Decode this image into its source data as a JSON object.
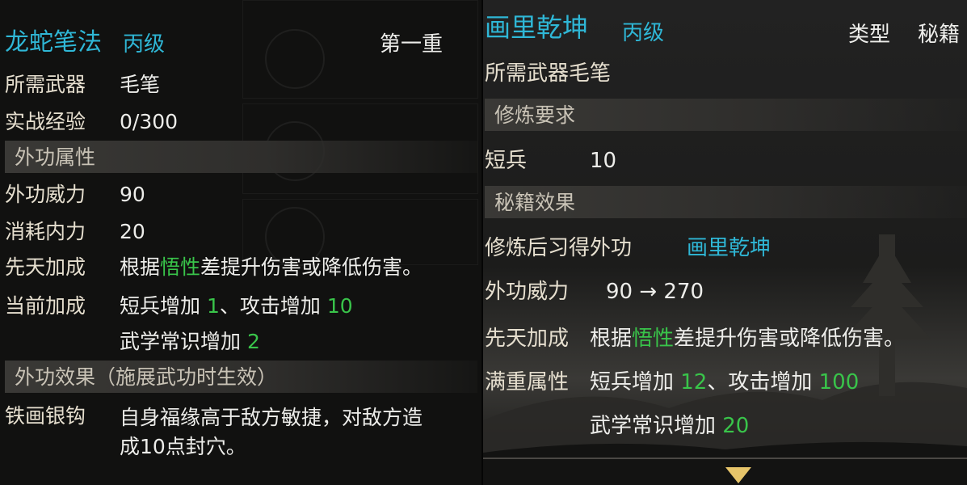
{
  "left": {
    "title": "龙蛇笔法",
    "grade": "丙级",
    "tier": "第一重",
    "weapon_label": "所需武器",
    "weapon_value": "毛笔",
    "exp_label": "实战经验",
    "exp_value": "0/300",
    "section_attr": "外功属性",
    "power_label": "外功威力",
    "power_value": "90",
    "cost_label": "消耗内力",
    "cost_value": "20",
    "innate_label": "先天加成",
    "innate_pre": "根据",
    "innate_hl": "悟性",
    "innate_post": "差提升伤害或降低伤害。",
    "current_label": "当前加成",
    "cur_line1_a": "短兵增加 ",
    "cur_line1_b": "1",
    "cur_line1_c": "、攻击增加 ",
    "cur_line1_d": "10",
    "cur_line2_a": "武学常识增加 ",
    "cur_line2_b": "2",
    "section_effect": "外功效果（施展武功时生效）",
    "effect_name": "铁画银钩",
    "effect_line1": "自身福缘高于敌方敏捷，对敌方造",
    "effect_line2": "成10点封穴。"
  },
  "right": {
    "title": "画里乾坤",
    "grade": "丙级",
    "type_label": "类型",
    "type_value": "秘籍",
    "weapon_text": "所需武器毛笔",
    "section_req": "修炼要求",
    "req_label": "短兵",
    "req_value": "10",
    "section_effect": "秘籍效果",
    "learn_label": "修炼后习得外功",
    "learn_value": "画里乾坤",
    "power_label": "外功威力",
    "power_value": "90 → 270",
    "innate_label": "先天加成",
    "innate_pre": "根据",
    "innate_hl": "悟性",
    "innate_post": "差提升伤害或降低伤害。",
    "full_label": "满重属性",
    "full_line1_a": "短兵增加 ",
    "full_line1_b": "12",
    "full_line1_c": "、攻击增加 ",
    "full_line1_d": "100",
    "full_line2_a": "武学常识增加 ",
    "full_line2_b": "20"
  },
  "colors": {
    "title_cyan": "#2fb7d6",
    "highlight_green": "#39c44a",
    "label_cream": "#e6dfcf",
    "arrow_gold": "#e7c56a"
  },
  "icons": [
    "scroll-down-arrow-icon"
  ]
}
